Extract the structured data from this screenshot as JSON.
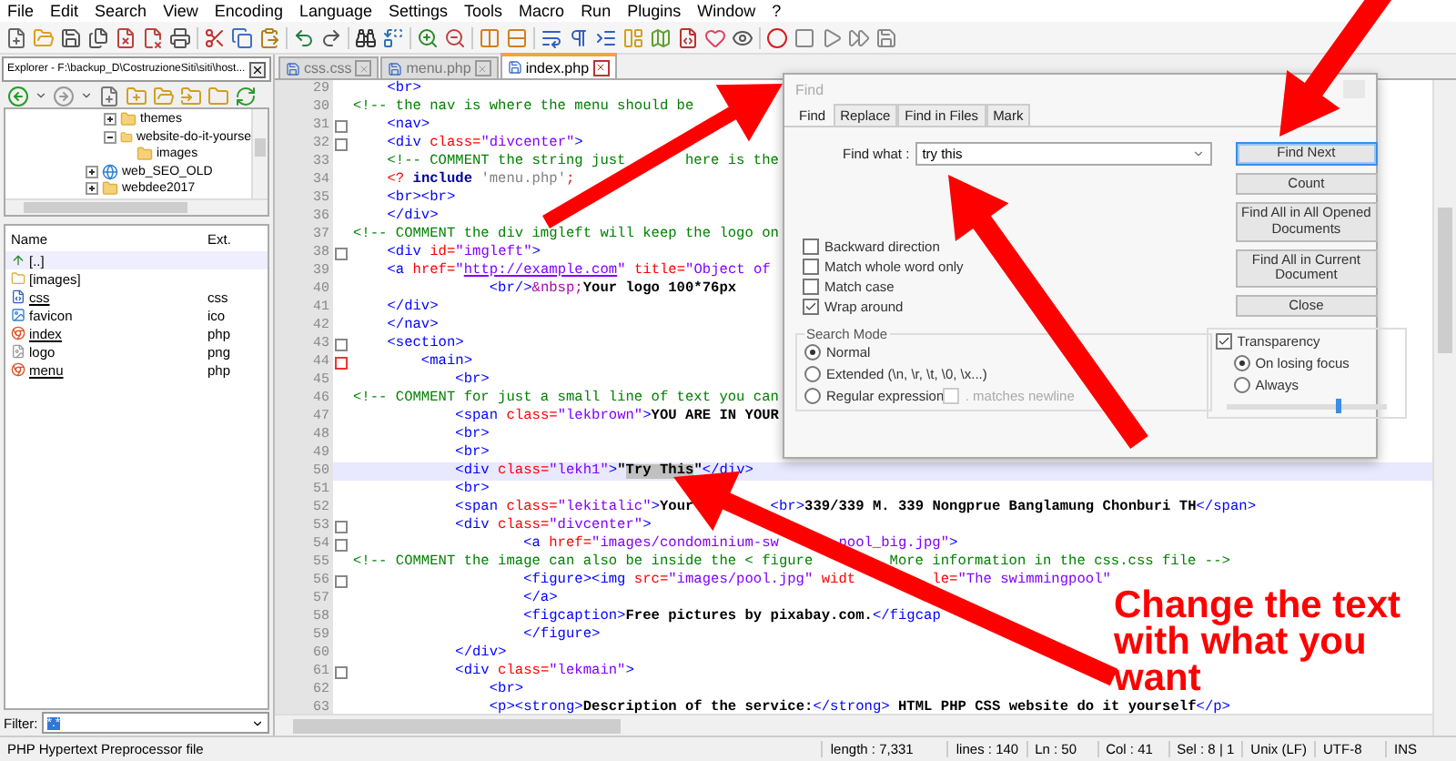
{
  "menu": [
    "File",
    "Edit",
    "Search",
    "View",
    "Encoding",
    "Language",
    "Settings",
    "Tools",
    "Macro",
    "Run",
    "Plugins",
    "Window",
    "?"
  ],
  "explorer": {
    "title": "Explorer - F:\\backup_D\\CostruzioneSiti\\siti\\host...",
    "tree_continued": [
      {
        "label": "themes",
        "expanded": false
      },
      {
        "label": "website-do-it-yourse",
        "expanded": true,
        "children": [
          {
            "label": "images"
          }
        ]
      }
    ],
    "tree": [
      {
        "label": "web_SEO_OLD",
        "kind": "site",
        "expanded": false
      },
      {
        "label": "webdee2017",
        "kind": "folder",
        "expanded": false
      }
    ],
    "columns": [
      "Name",
      "Ext."
    ],
    "files": [
      {
        "name": "[..]",
        "kind": "up"
      },
      {
        "name": "[images]",
        "kind": "folder"
      },
      {
        "name": "css",
        "ext": "css",
        "kind": "css"
      },
      {
        "name": "favicon",
        "ext": "ico",
        "kind": "image"
      },
      {
        "name": "index",
        "ext": "php",
        "kind": "php"
      },
      {
        "name": "logo",
        "ext": "png",
        "kind": "png"
      },
      {
        "name": "menu",
        "ext": "php",
        "kind": "php"
      }
    ],
    "filter": {
      "label": "Filter:",
      "value": "*.*"
    }
  },
  "tabs": [
    {
      "label": "css.css",
      "selected": false
    },
    {
      "label": "menu.php",
      "selected": false
    },
    {
      "label": "index.php",
      "selected": true
    }
  ],
  "code": [
    {
      "n": "29",
      "fold": false,
      "selected": false,
      "segs": [
        {
          "kind": "tag",
          "text": "    <br>"
        }
      ]
    },
    {
      "n": "30",
      "fold": false,
      "selected": false,
      "segs": [
        {
          "kind": "cmt",
          "text": "<!-- the nav is where the menu should be"
        }
      ]
    },
    {
      "n": "31",
      "fold": true,
      "selected": false,
      "segs": [
        {
          "kind": "tag",
          "text": "    <nav>"
        }
      ]
    },
    {
      "n": "32",
      "fold": true,
      "selected": false,
      "segs": [
        {
          "kind": "tag",
          "text": "    <div "
        },
        {
          "kind": "attr",
          "text": "class="
        },
        {
          "kind": "val",
          "text": "\"divcenter\""
        },
        {
          "kind": "tag",
          "text": ">"
        }
      ]
    },
    {
      "n": "33",
      "fold": false,
      "selected": false,
      "segs": [
        {
          "kind": "cmt",
          "text": "    <!-- COMMENT the string just       here is the"
        }
      ]
    },
    {
      "n": "34",
      "fold": false,
      "selected": false,
      "segs": [
        {
          "kind": "php",
          "text": "    <? "
        },
        {
          "kind": "kw",
          "text": "include "
        },
        {
          "kind": "str",
          "text": "'menu.php'"
        },
        {
          "kind": "php",
          "text": ";"
        }
      ]
    },
    {
      "n": "35",
      "fold": false,
      "selected": false,
      "segs": [
        {
          "kind": "tag",
          "text": "    <br><br>"
        }
      ]
    },
    {
      "n": "36",
      "fold": false,
      "selected": false,
      "segs": [
        {
          "kind": "tag",
          "text": "    </div>"
        }
      ]
    },
    {
      "n": "37",
      "fold": false,
      "selected": false,
      "segs": [
        {
          "kind": "cmt",
          "text": "<!-- COMMENT the div imgleft will keep the logo on"
        }
      ]
    },
    {
      "n": "38",
      "fold": true,
      "selected": false,
      "segs": [
        {
          "kind": "tag",
          "text": "    <div "
        },
        {
          "kind": "attr",
          "text": "id="
        },
        {
          "kind": "val",
          "text": "\"imgleft\""
        },
        {
          "kind": "tag",
          "text": ">"
        }
      ]
    },
    {
      "n": "39",
      "fold": false,
      "selected": false,
      "segs": [
        {
          "kind": "tag",
          "text": "    <a "
        },
        {
          "kind": "attr",
          "text": "href="
        },
        {
          "kind": "val",
          "text": "\""
        },
        {
          "kind": "link",
          "text": "http://example.com"
        },
        {
          "kind": "val",
          "text": "\""
        },
        {
          "kind": "attr",
          "text": " title="
        },
        {
          "kind": "val",
          "text": "\"Object of"
        }
      ]
    },
    {
      "n": "40",
      "fold": false,
      "selected": false,
      "segs": [
        {
          "kind": "tag",
          "text": "                <br/>"
        },
        {
          "kind": "ent",
          "text": "&nbsp;"
        },
        {
          "kind": "text",
          "text": "Your logo 100*76px"
        }
      ]
    },
    {
      "n": "41",
      "fold": false,
      "selected": false,
      "segs": [
        {
          "kind": "tag",
          "text": "    </div>"
        }
      ]
    },
    {
      "n": "42",
      "fold": false,
      "selected": false,
      "segs": [
        {
          "kind": "tag",
          "text": "    </nav>"
        }
      ]
    },
    {
      "n": "43",
      "fold": true,
      "selected": false,
      "segs": [
        {
          "kind": "tag",
          "text": "    <section>"
        }
      ]
    },
    {
      "n": "44",
      "fold": true,
      "selected": false,
      "segs": [
        {
          "kind": "tag",
          "text": "        <main>"
        }
      ]
    },
    {
      "n": "45",
      "fold": false,
      "selected": false,
      "segs": [
        {
          "kind": "tag",
          "text": "            <br>"
        }
      ]
    },
    {
      "n": "46",
      "fold": false,
      "selected": false,
      "segs": [
        {
          "kind": "cmt",
          "text": "<!-- COMMENT for just a small line of text you can"
        }
      ]
    },
    {
      "n": "47",
      "fold": false,
      "selected": false,
      "segs": [
        {
          "kind": "tag",
          "text": "            <span "
        },
        {
          "kind": "attr",
          "text": "class="
        },
        {
          "kind": "val",
          "text": "\"lekbrown\""
        },
        {
          "kind": "tag",
          "text": ">"
        },
        {
          "kind": "text",
          "text": "YOU ARE IN YOUR"
        }
      ]
    },
    {
      "n": "48",
      "fold": false,
      "selected": false,
      "segs": [
        {
          "kind": "tag",
          "text": "            <br>"
        }
      ]
    },
    {
      "n": "49",
      "fold": false,
      "selected": false,
      "segs": [
        {
          "kind": "tag",
          "text": "            <br>"
        }
      ]
    },
    {
      "n": "50",
      "fold": false,
      "selected": true,
      "segs": [
        {
          "kind": "tag",
          "text": "            <div "
        },
        {
          "kind": "attr",
          "text": "class="
        },
        {
          "kind": "val",
          "text": "\"lekh1\""
        },
        {
          "kind": "tag",
          "text": ">"
        },
        {
          "kind": "text",
          "text": "\""
        },
        {
          "kind": "sel",
          "text": "Try This"
        },
        {
          "kind": "text",
          "text": "\""
        },
        {
          "kind": "tag",
          "text": "</div>"
        }
      ]
    },
    {
      "n": "51",
      "fold": false,
      "selected": false,
      "segs": [
        {
          "kind": "tag",
          "text": "            <br>"
        }
      ]
    },
    {
      "n": "52",
      "fold": false,
      "selected": false,
      "segs": [
        {
          "kind": "tag",
          "text": "            <span "
        },
        {
          "kind": "attr",
          "text": "class="
        },
        {
          "kind": "val",
          "text": "\"lekitalic\""
        },
        {
          "kind": "tag",
          "text": ">"
        },
        {
          "kind": "text",
          "text": "Your         "
        },
        {
          "kind": "tag",
          "text": "<br>"
        },
        {
          "kind": "text",
          "text": "339/339 M. 339 Nongprue Banglamung Chonburi TH"
        },
        {
          "kind": "tag",
          "text": "</span>"
        }
      ]
    },
    {
      "n": "53",
      "fold": true,
      "selected": false,
      "segs": [
        {
          "kind": "tag",
          "text": "            <div "
        },
        {
          "kind": "attr",
          "text": "class="
        },
        {
          "kind": "val",
          "text": "\"divcenter\""
        },
        {
          "kind": "tag",
          "text": ">"
        }
      ]
    },
    {
      "n": "54",
      "fold": true,
      "selected": false,
      "segs": [
        {
          "kind": "tag",
          "text": "                    <a "
        },
        {
          "kind": "attr",
          "text": "href="
        },
        {
          "kind": "val",
          "text": "\"images/condominium-sw       pool_big.jpg\""
        },
        {
          "kind": "tag",
          "text": ">"
        }
      ]
    },
    {
      "n": "55",
      "fold": false,
      "selected": false,
      "segs": [
        {
          "kind": "cmt",
          "text": "<!-- COMMENT the image can also be inside the < figure         More information in the css.css file -->"
        }
      ]
    },
    {
      "n": "56",
      "fold": true,
      "selected": false,
      "segs": [
        {
          "kind": "tag",
          "text": "                    <figure><img "
        },
        {
          "kind": "attr",
          "text": "src="
        },
        {
          "kind": "val",
          "text": "\"images/pool.jpg\""
        },
        {
          "kind": "attr",
          "text": " widt         le="
        },
        {
          "kind": "val",
          "text": "\"The swimmingpool\""
        }
      ]
    },
    {
      "n": "57",
      "fold": false,
      "selected": false,
      "segs": [
        {
          "kind": "tag",
          "text": "                    </a>"
        }
      ]
    },
    {
      "n": "58",
      "fold": false,
      "selected": false,
      "segs": [
        {
          "kind": "tag",
          "text": "                    <figcaption>"
        },
        {
          "kind": "text",
          "text": "Free pictures by pixabay.com."
        },
        {
          "kind": "tag",
          "text": "</figcap"
        }
      ]
    },
    {
      "n": "59",
      "fold": false,
      "selected": false,
      "segs": [
        {
          "kind": "tag",
          "text": "                    </figure>"
        }
      ]
    },
    {
      "n": "60",
      "fold": false,
      "selected": false,
      "segs": [
        {
          "kind": "tag",
          "text": "            </div>"
        }
      ]
    },
    {
      "n": "61",
      "fold": true,
      "selected": false,
      "segs": [
        {
          "kind": "tag",
          "text": "            <div "
        },
        {
          "kind": "attr",
          "text": "class="
        },
        {
          "kind": "val",
          "text": "\"lekmain\""
        },
        {
          "kind": "tag",
          "text": ">"
        }
      ]
    },
    {
      "n": "62",
      "fold": false,
      "selected": false,
      "segs": [
        {
          "kind": "tag",
          "text": "                <br>"
        }
      ]
    },
    {
      "n": "63",
      "fold": false,
      "selected": false,
      "segs": [
        {
          "kind": "tag",
          "text": "                <p><strong>"
        },
        {
          "kind": "text",
          "text": "Description of the service:"
        },
        {
          "kind": "tag",
          "text": "</strong>"
        },
        {
          "kind": "text",
          "text": " HTML PHP CSS website do it yourself"
        },
        {
          "kind": "tag",
          "text": "</p>"
        }
      ]
    }
  ],
  "find_dialog": {
    "title": "Find",
    "tabs": [
      {
        "label": "Find",
        "selected": true
      },
      {
        "label": "Replace",
        "selected": false
      },
      {
        "label": "Find in Files",
        "selected": false
      },
      {
        "label": "Mark",
        "selected": false
      }
    ],
    "find_what": {
      "label": "Find what :",
      "value": "try this"
    },
    "buttons": [
      {
        "label": "Find Next",
        "focused": true
      },
      {
        "label": "Count",
        "focused": false
      },
      {
        "label": "Find All in All Opened Documents",
        "focused": false
      },
      {
        "label": "Find All in Current Document",
        "focused": false
      },
      {
        "label": "Close",
        "focused": false
      }
    ],
    "options": [
      {
        "label": "Backward direction",
        "checked": false
      },
      {
        "label": "Match whole word only",
        "checked": false
      },
      {
        "label": "Match case",
        "checked": false
      },
      {
        "label": "Wrap around",
        "checked": true
      }
    ],
    "search_mode": {
      "title": "Search Mode",
      "modes": [
        {
          "label": "Normal",
          "selected": true
        },
        {
          "label": "Extended (\\n, \\r, \\t, \\0, \\x...)",
          "selected": false
        },
        {
          "label": "Regular expression",
          "selected": false
        }
      ],
      "newline": {
        "label": ". matches newline",
        "checked": false,
        "disabled": true
      }
    },
    "transparency": {
      "label": "Transparency",
      "checked": true,
      "modes": [
        {
          "label": "On losing focus",
          "selected": true
        },
        {
          "label": "Always",
          "selected": false
        }
      ],
      "level": 0.7
    }
  },
  "status_bar": [
    {
      "text": "PHP Hypertext Preprocessor file",
      "kind": "wide"
    },
    {
      "text": "length : 7,331",
      "kind": "cell"
    },
    {
      "text": "lines : 140",
      "kind": "cell"
    },
    {
      "text": "Ln : 50",
      "kind": "cell"
    },
    {
      "text": "Col : 41",
      "kind": "cell"
    },
    {
      "text": "Sel : 8 | 1",
      "kind": "cell"
    },
    {
      "text": "Unix (LF)",
      "kind": "cell"
    },
    {
      "text": "UTF-8",
      "kind": "cell"
    },
    {
      "text": "INS",
      "kind": "cell"
    }
  ],
  "annotation": {
    "text": "Change the text with what you want"
  }
}
